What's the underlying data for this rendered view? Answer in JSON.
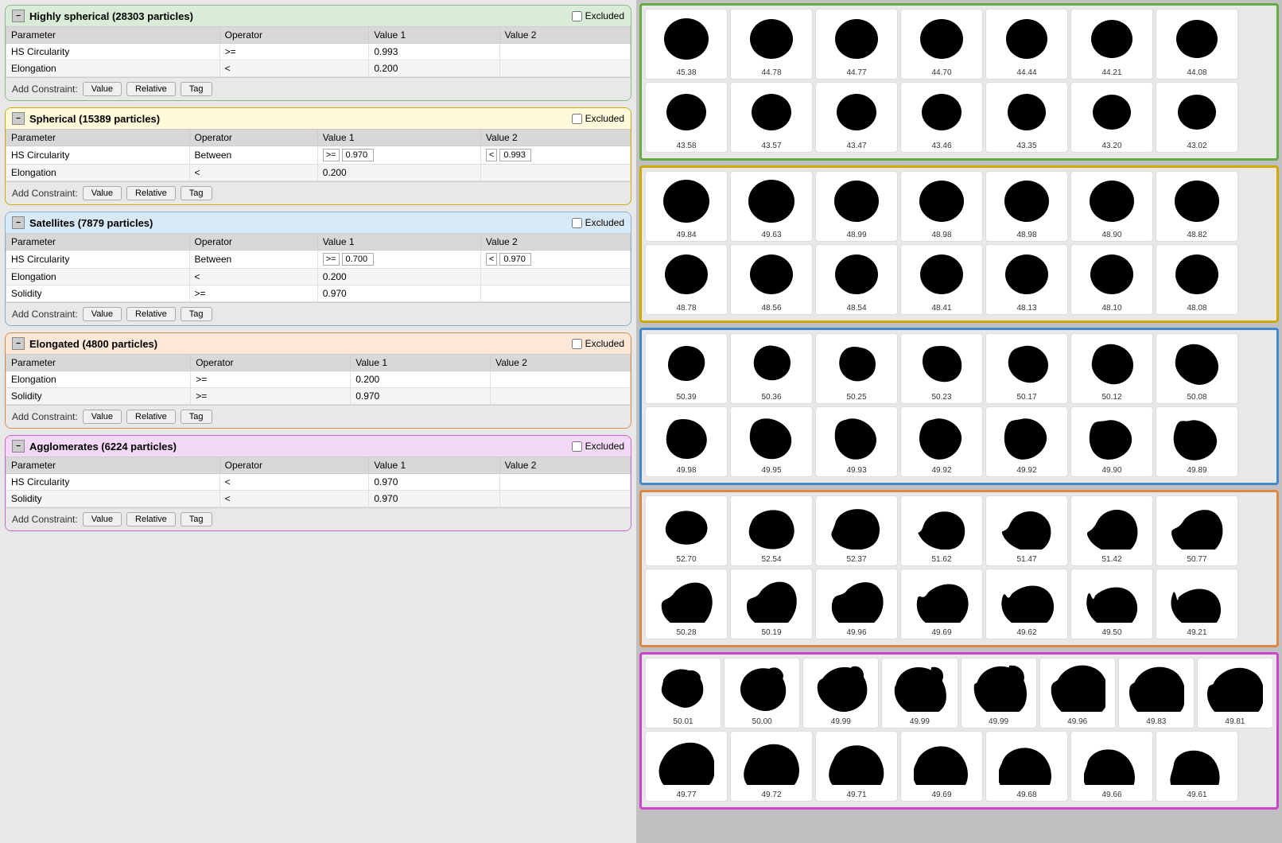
{
  "groups": [
    {
      "id": "highly-spherical",
      "title": "Highly spherical (28303 particles)",
      "colorClass": "highly-spherical",
      "excluded": false,
      "parameters": [
        {
          "parameter": "HS Circularity",
          "operator": ">=",
          "value1": "0.993",
          "value2": ""
        },
        {
          "parameter": "Elongation",
          "operator": "<",
          "value1": "0.200",
          "value2": ""
        }
      ],
      "headers": [
        "Parameter",
        "Operator",
        "Value 1",
        "Value 2"
      ]
    },
    {
      "id": "spherical",
      "title": "Spherical (15389 particles)",
      "colorClass": "spherical",
      "excluded": false,
      "parameters": [
        {
          "parameter": "HS Circularity",
          "operator": "Between",
          "value1": ">=0.970",
          "value2": "< 0.993",
          "isBetween": true
        },
        {
          "parameter": "Elongation",
          "operator": "<",
          "value1": "0.200",
          "value2": ""
        }
      ],
      "headers": [
        "Parameter",
        "Operator",
        "Value 1",
        "Value 2"
      ]
    },
    {
      "id": "satellites",
      "title": "Satellites (7879 particles)",
      "colorClass": "satellites",
      "excluded": false,
      "parameters": [
        {
          "parameter": "HS Circularity",
          "operator": "Between",
          "value1": ">=0.700",
          "value2": "< 0.970",
          "isBetween": true
        },
        {
          "parameter": "Elongation",
          "operator": "<",
          "value1": "0.200",
          "value2": ""
        },
        {
          "parameter": "Solidity",
          "operator": ">=",
          "value1": "0.970",
          "value2": ""
        }
      ],
      "headers": [
        "Parameter",
        "Operator",
        "Value 1",
        "Value 2"
      ]
    },
    {
      "id": "elongated",
      "title": "Elongated (4800 particles)",
      "colorClass": "elongated",
      "excluded": false,
      "parameters": [
        {
          "parameter": "Elongation",
          "operator": ">=",
          "value1": "0.200",
          "value2": ""
        },
        {
          "parameter": "Solidity",
          "operator": ">=",
          "value1": "0.970",
          "value2": ""
        }
      ],
      "headers": [
        "Parameter",
        "Operator",
        "Value 1",
        "Value 2"
      ]
    },
    {
      "id": "agglomerates",
      "title": "Agglomerates (6224 particles)",
      "colorClass": "agglomerates",
      "excluded": false,
      "parameters": [
        {
          "parameter": "HS Circularity",
          "operator": "<",
          "value1": "0.970",
          "value2": ""
        },
        {
          "parameter": "Solidity",
          "operator": "<",
          "value1": "0.970",
          "value2": ""
        }
      ],
      "headers": [
        "Parameter",
        "Operator",
        "Value 1",
        "Value 2"
      ]
    }
  ],
  "buttons": {
    "value": "Value",
    "relative": "Relative",
    "tag": "Tag",
    "addConstraint": "Add Constraint:"
  },
  "excludedLabel": "Excluded",
  "imageSections": {
    "green": {
      "rows": [
        [
          {
            "label": "45.38",
            "shape": "full"
          },
          {
            "label": "44.78",
            "shape": "full"
          },
          {
            "label": "44.77",
            "shape": "full"
          },
          {
            "label": "44.70",
            "shape": "full"
          },
          {
            "label": "44.44",
            "shape": "full"
          },
          {
            "label": "44.21",
            "shape": "full"
          },
          {
            "label": "44.08",
            "shape": "full"
          }
        ],
        [
          {
            "label": "43.58",
            "shape": "full"
          },
          {
            "label": "43.57",
            "shape": "full"
          },
          {
            "label": "43.47",
            "shape": "full"
          },
          {
            "label": "43.46",
            "shape": "full"
          },
          {
            "label": "43.35",
            "shape": "full"
          },
          {
            "label": "43.20",
            "shape": "full"
          },
          {
            "label": "43.02",
            "shape": "full"
          }
        ]
      ]
    },
    "yellow": {
      "rows": [
        [
          {
            "label": "49.84",
            "shape": "full"
          },
          {
            "label": "49.63",
            "shape": "full"
          },
          {
            "label": "48.99",
            "shape": "full"
          },
          {
            "label": "48.98",
            "shape": "full"
          },
          {
            "label": "48.98",
            "shape": "full"
          },
          {
            "label": "48.90",
            "shape": "full"
          },
          {
            "label": "48.82",
            "shape": "full"
          }
        ],
        [
          {
            "label": "48.78",
            "shape": "full"
          },
          {
            "label": "48.56",
            "shape": "full"
          },
          {
            "label": "48.54",
            "shape": "full"
          },
          {
            "label": "48.41",
            "shape": "full"
          },
          {
            "label": "48.13",
            "shape": "full"
          },
          {
            "label": "48.10",
            "shape": "full"
          },
          {
            "label": "48.08",
            "shape": "full"
          }
        ]
      ]
    },
    "blue": {
      "rows": [
        [
          {
            "label": "50.39",
            "shape": "satellite1"
          },
          {
            "label": "50.36",
            "shape": "satellite2"
          },
          {
            "label": "50.25",
            "shape": "satellite3"
          },
          {
            "label": "50.23",
            "shape": "satellite4"
          },
          {
            "label": "50.17",
            "shape": "satellite5"
          },
          {
            "label": "50.12",
            "shape": "satellite6"
          },
          {
            "label": "50.08",
            "shape": "satellite7"
          }
        ],
        [
          {
            "label": "49.98",
            "shape": "satellite8"
          },
          {
            "label": "49.95",
            "shape": "satellite9"
          },
          {
            "label": "49.93",
            "shape": "satellite10"
          },
          {
            "label": "49.92",
            "shape": "satellite11"
          },
          {
            "label": "49.92",
            "shape": "satellite12"
          },
          {
            "label": "49.90",
            "shape": "satellite13"
          },
          {
            "label": "49.89",
            "shape": "satellite14"
          }
        ]
      ]
    },
    "orange": {
      "rows": [
        [
          {
            "label": "52.70",
            "shape": "elongated1"
          },
          {
            "label": "52.54",
            "shape": "elongated2"
          },
          {
            "label": "52.37",
            "shape": "elongated3"
          },
          {
            "label": "51.62",
            "shape": "elongated4"
          },
          {
            "label": "51.47",
            "shape": "elongated5"
          },
          {
            "label": "51.42",
            "shape": "elongated6"
          },
          {
            "label": "50.77",
            "shape": "elongated7"
          }
        ],
        [
          {
            "label": "50.28",
            "shape": "elongated8"
          },
          {
            "label": "50.19",
            "shape": "elongated9"
          },
          {
            "label": "49.96",
            "shape": "elongated10"
          },
          {
            "label": "49.69",
            "shape": "elongated11"
          },
          {
            "label": "49.62",
            "shape": "elongated12"
          },
          {
            "label": "49.50",
            "shape": "elongated13"
          },
          {
            "label": "49.21",
            "shape": "elongated14"
          }
        ]
      ]
    },
    "purple": {
      "rows": [
        [
          {
            "label": "50.01",
            "shape": "agglom1"
          },
          {
            "label": "50.00",
            "shape": "agglom2"
          },
          {
            "label": "49.99",
            "shape": "agglom3"
          },
          {
            "label": "49.99",
            "shape": "agglom4"
          },
          {
            "label": "49.99",
            "shape": "agglom5"
          },
          {
            "label": "49.96",
            "shape": "agglom6"
          },
          {
            "label": "49.83",
            "shape": "agglom7"
          },
          {
            "label": "49.81",
            "shape": "agglom8"
          }
        ],
        [
          {
            "label": "49.77",
            "shape": "agglom9"
          },
          {
            "label": "49.72",
            "shape": "agglom10"
          },
          {
            "label": "49.71",
            "shape": "agglom11"
          },
          {
            "label": "49.69",
            "shape": "agglom12"
          },
          {
            "label": "49.68",
            "shape": "agglom13"
          },
          {
            "label": "49.66",
            "shape": "agglom14"
          },
          {
            "label": "49.61",
            "shape": "agglom15"
          }
        ]
      ]
    }
  }
}
